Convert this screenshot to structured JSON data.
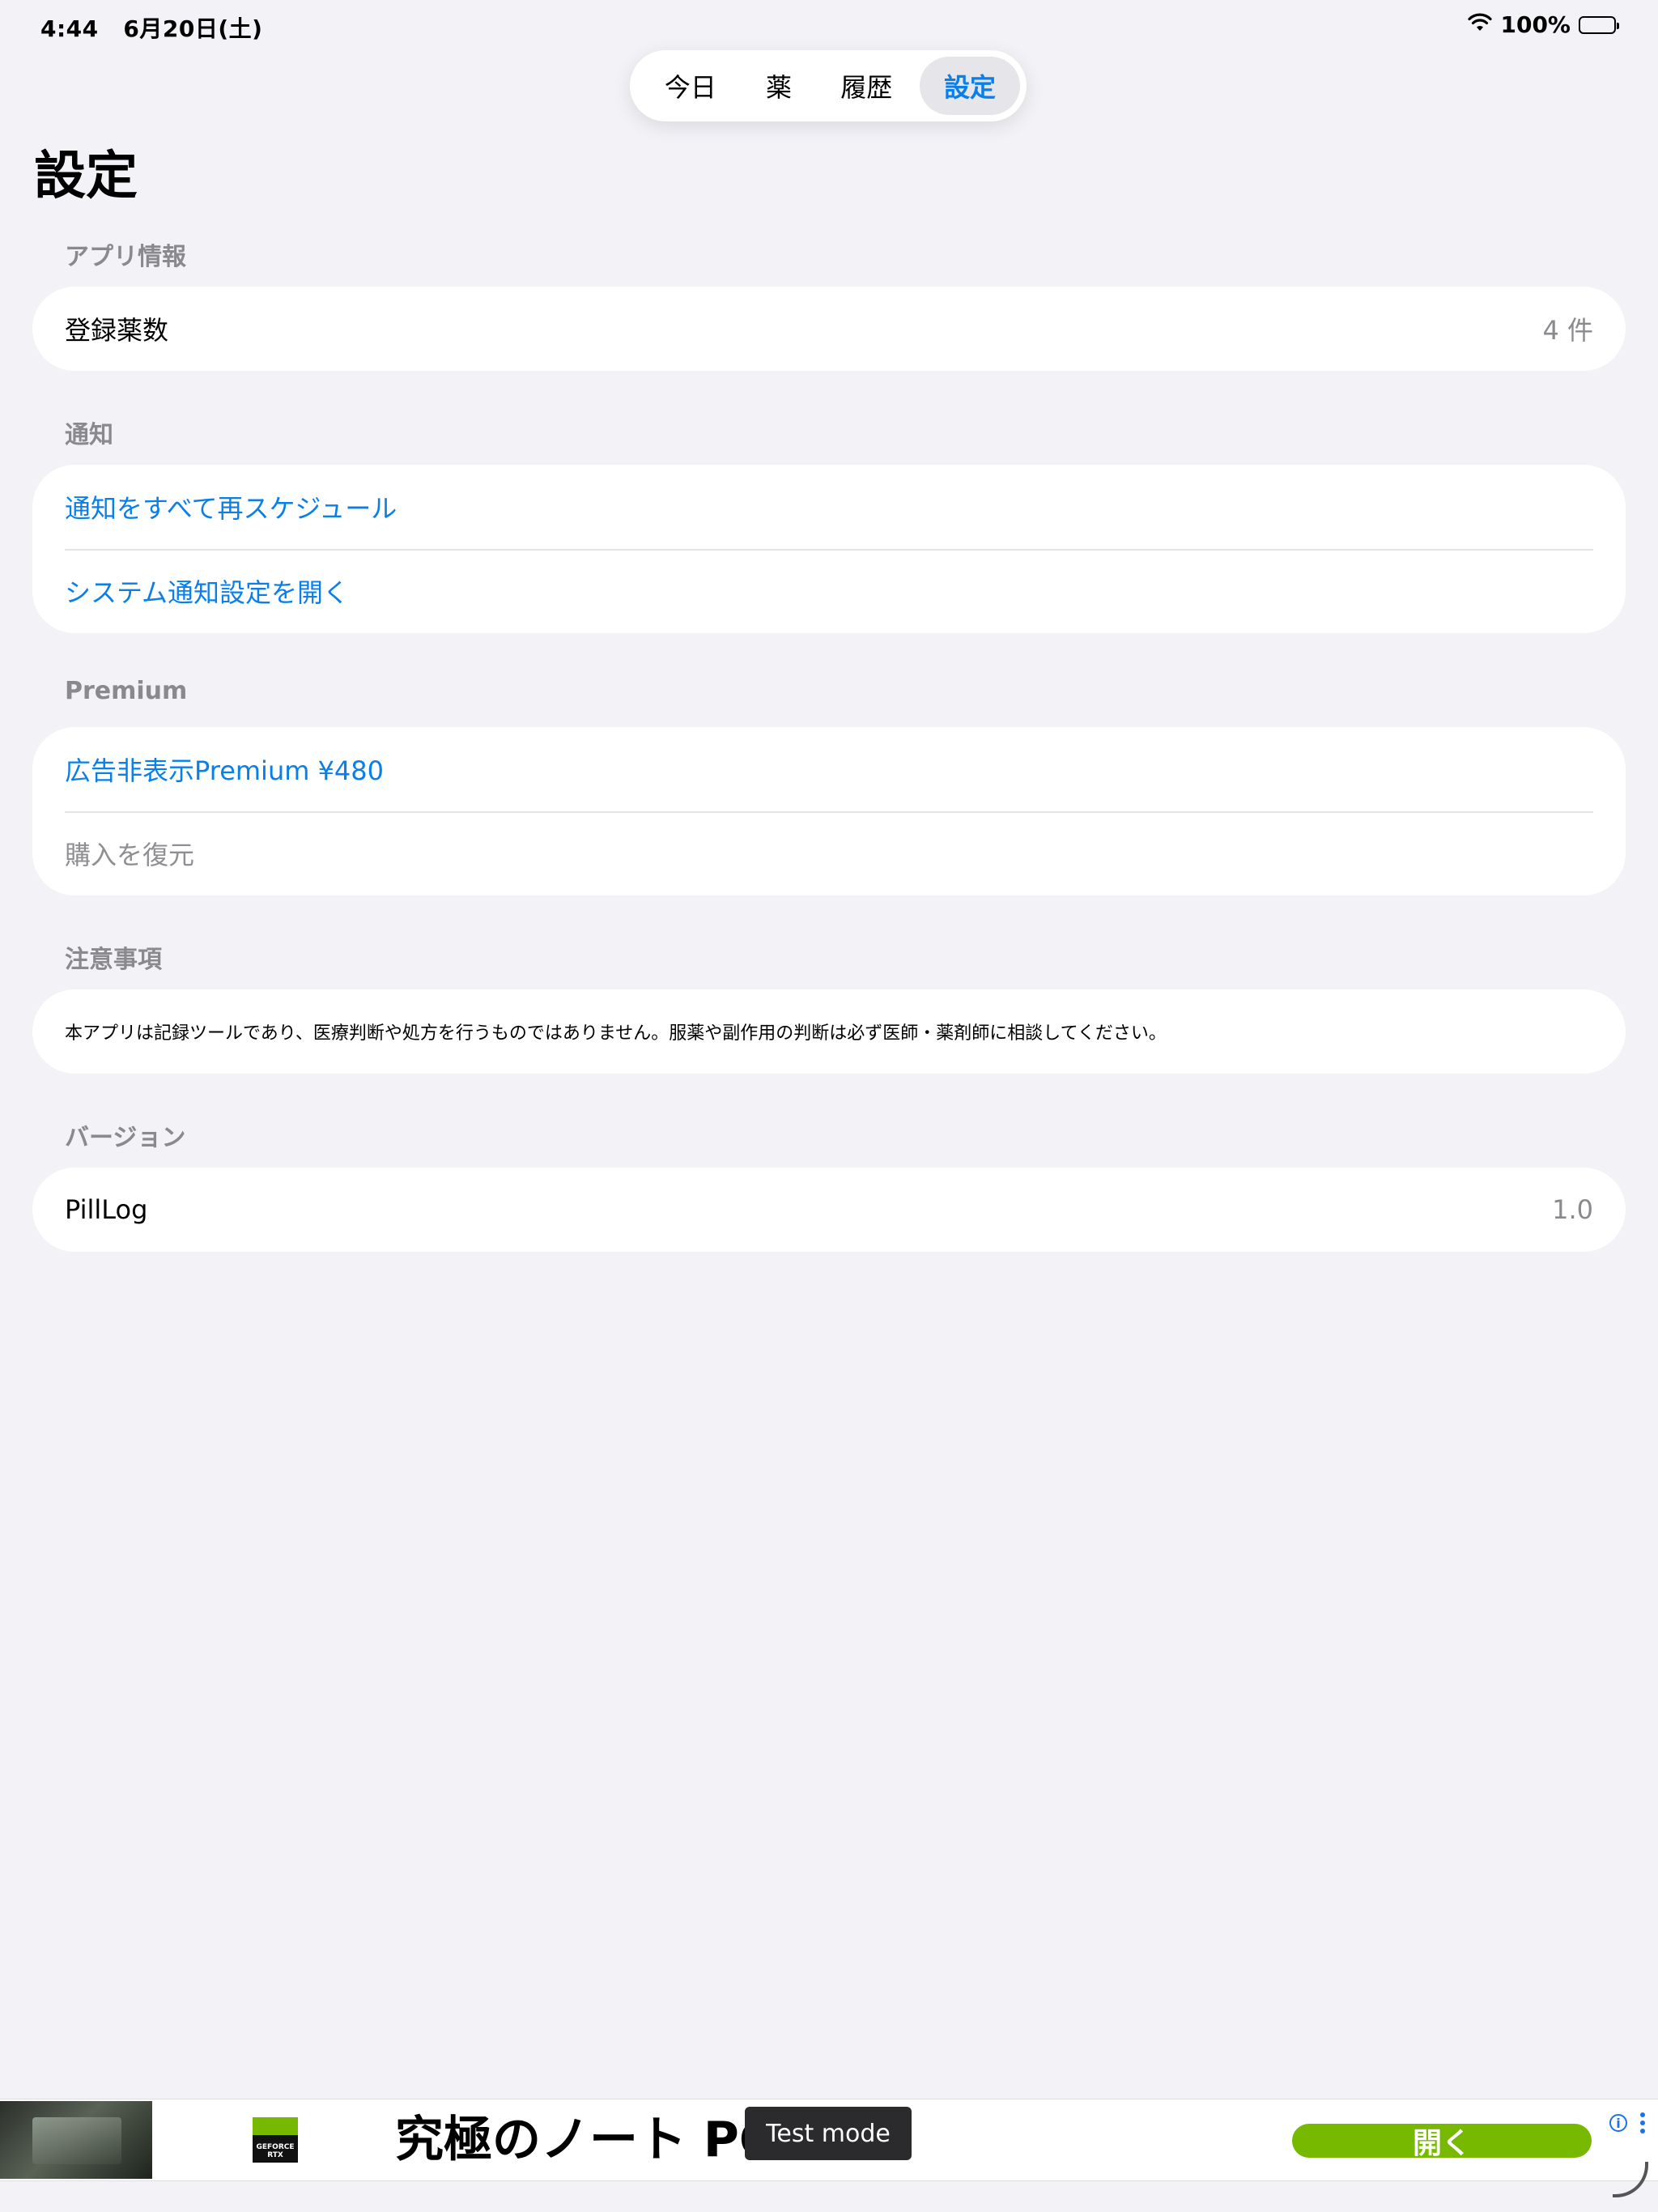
{
  "status_bar": {
    "time": "4:44",
    "date": "6月20日(土)",
    "wifi_icon": "wifi-icon",
    "battery_text": "100%",
    "battery_icon": "battery-full-icon"
  },
  "tabs": [
    {
      "label": "今日"
    },
    {
      "label": "薬"
    },
    {
      "label": "履歴"
    },
    {
      "label": "設定",
      "active": true
    }
  ],
  "page": {
    "title": "設定"
  },
  "sections": {
    "app_info": {
      "header": "アプリ情報",
      "rows": [
        {
          "label": "登録薬数",
          "value": "4 件"
        }
      ]
    },
    "notifications": {
      "header": "通知",
      "rows": [
        {
          "label": "通知をすべて再スケジュール"
        },
        {
          "label": "システム通知設定を開く"
        }
      ]
    },
    "premium": {
      "header": "Premium",
      "rows": [
        {
          "label": "広告非表示Premium ¥480"
        },
        {
          "label": "購入を復元"
        }
      ]
    },
    "notes": {
      "header": "注意事項",
      "text": "本アプリは記録ツールであり、医療判断や処方を行うものではありません。服薬や副作用の判断は必ず医師・薬剤師に相談してください。"
    },
    "version": {
      "header": "バージョン",
      "rows": [
        {
          "label": "PillLog",
          "value": "1.0"
        }
      ]
    }
  },
  "ad": {
    "logo_text": "GEFORCE RTX",
    "headline": "究極のノート PC",
    "cta": "開く",
    "info_icon": "info-icon",
    "test_mode": "Test mode"
  },
  "colors": {
    "accent": "#0a7fe8",
    "background": "#f2f2f7",
    "secondary_text": "#8a8a8e",
    "ad_green": "#76b900"
  }
}
